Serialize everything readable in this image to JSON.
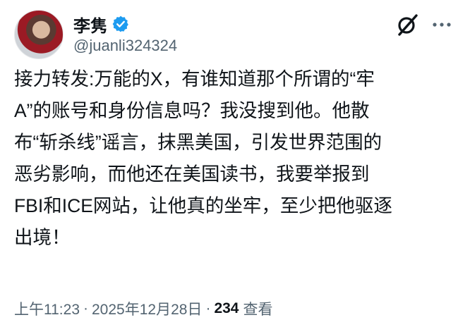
{
  "post": {
    "author": {
      "display_name": "李隽",
      "handle": "@juanli324324",
      "verified": true,
      "verified_color": "#1d9bf0"
    },
    "text": "接力转发:万能的X，有谁知道那个所谓的“牢\nA”的账号和身份信息吗？我没搜到他。他散\n布“斩杀线”谣言，抹黑美国，引发世界范围的\n恶劣影响，而他还在美国读书，我要举报到\nFBI和ICE网站，让他真的坐牢，至少把他驱逐\n出境！",
    "meta": {
      "time": "上午11:23",
      "separator": "·",
      "date": "2025年12月28日",
      "views_count": "234",
      "views_label": "查看"
    },
    "icons": [
      "avatar",
      "verified-badge-icon",
      "grok-icon",
      "more-icon"
    ],
    "colors": {
      "text": "#0f1419",
      "secondary": "#536471",
      "accent": "#1d9bf0"
    }
  }
}
